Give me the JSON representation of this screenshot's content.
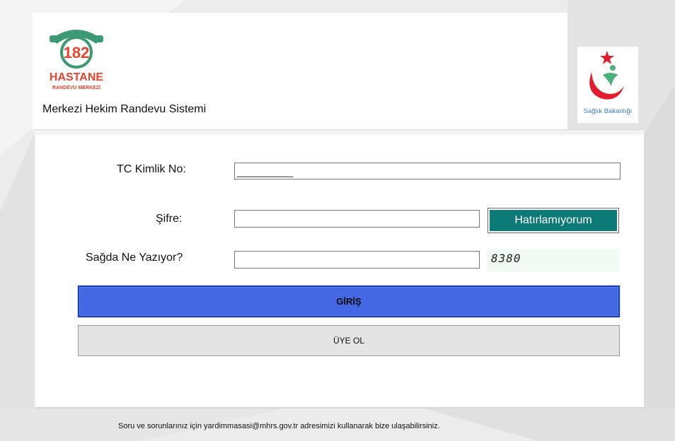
{
  "header": {
    "logo_number": "182",
    "logo_line1": "HASTANE",
    "logo_line2": "RANDEVU MERKEZİ",
    "system_title": "Merkezi Hekim Randevu Sistemi",
    "ministry_logo_text": "Sağlık Bakanlığı"
  },
  "form": {
    "tc_label": "TC Kimlik No:",
    "tc_value": "___________",
    "password_label": "Şifre:",
    "password_value": "",
    "forgot_button": "Hatırlamıyorum",
    "captcha_label": "Sağda Ne Yazıyor?",
    "captcha_value": "",
    "captcha_text": "8380",
    "login_button": "GİRİŞ",
    "register_button": "ÜYE OL"
  },
  "footer": {
    "text": "Soru ve sorunlarınız için yardimmasasi@mhrs.gov.tr adresimizi kullanarak bize ulaşabilirsiniz."
  },
  "colors": {
    "teal_button": "#0c7a76",
    "login_blue": "#4468e4",
    "logo_red": "#e8432e",
    "logo_green": "#3c9a73"
  }
}
